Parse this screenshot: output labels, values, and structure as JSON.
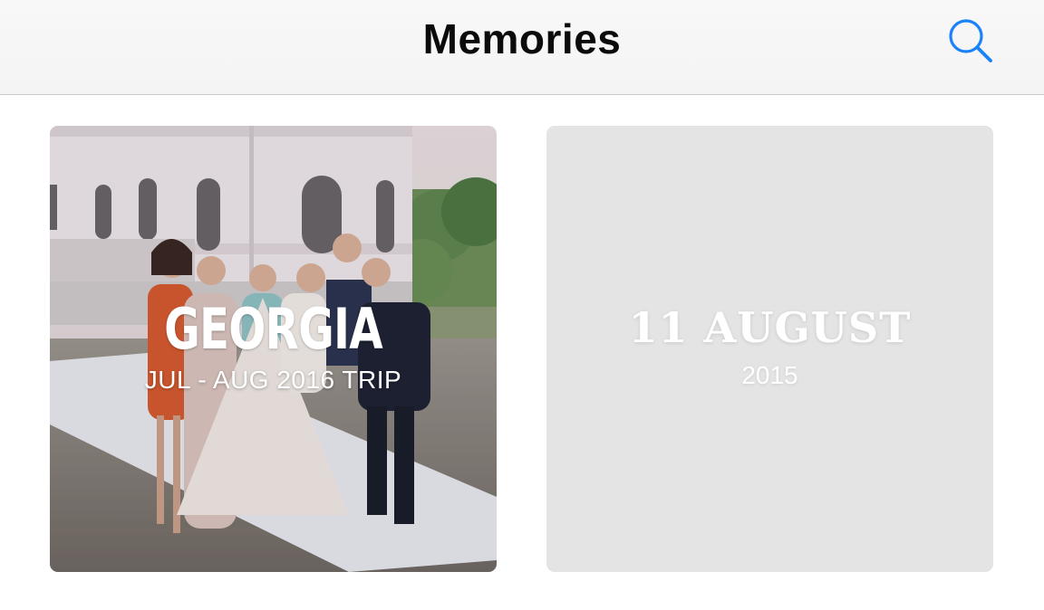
{
  "navbar": {
    "title": "Memories",
    "search_icon": "search-icon",
    "accent_color": "#1a82fb"
  },
  "memories": [
    {
      "title": "GEORGIA",
      "subtitle": "JUL - AUG 2016 TRIP",
      "image": "wedding-group-photo"
    },
    {
      "title": "11 AUGUST",
      "subtitle": "2015",
      "placeholder_color": "#e4e4e4"
    }
  ]
}
